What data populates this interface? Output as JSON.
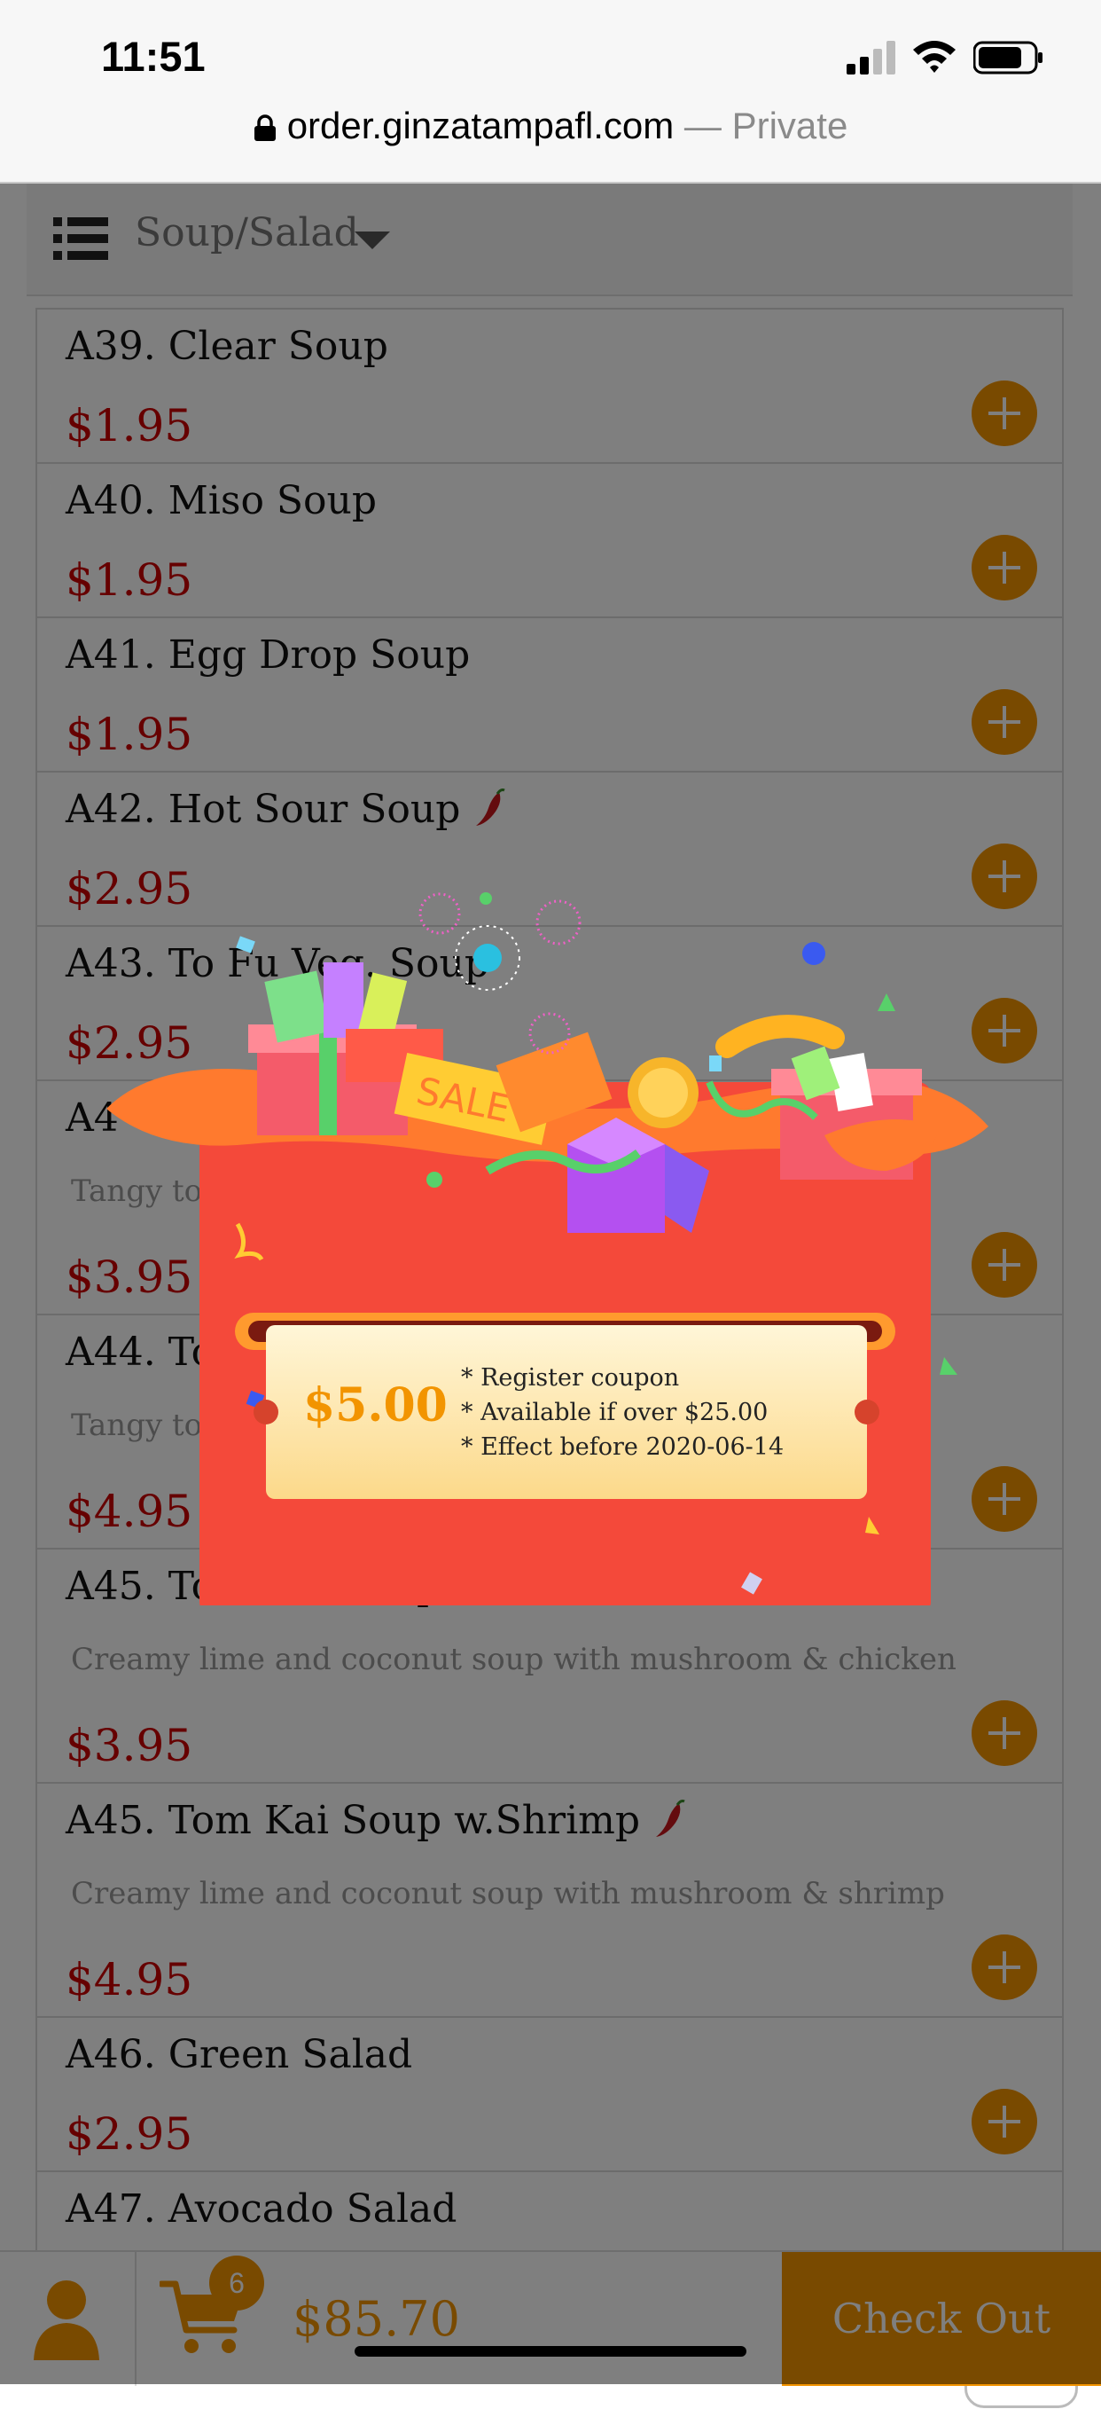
{
  "status": {
    "time": "11:51"
  },
  "browser": {
    "domain": "order.ginzatampafl.com",
    "separator": " — ",
    "mode": "Private"
  },
  "category": {
    "label": "Soup/Salad"
  },
  "menu": [
    {
      "name": "A39. Clear Soup",
      "price": "$1.95",
      "desc": "",
      "spicy": false
    },
    {
      "name": "A40. Miso Soup",
      "price": "$1.95",
      "desc": "",
      "spicy": false
    },
    {
      "name": "A41. Egg Drop Soup",
      "price": "$1.95",
      "desc": "",
      "spicy": false
    },
    {
      "name": "A42. Hot Sour Soup",
      "price": "$2.95",
      "desc": "",
      "spicy": true
    },
    {
      "name": "A43. To Fu Veg. Soup",
      "price": "$2.95",
      "desc": "",
      "spicy": false
    },
    {
      "name": "A4",
      "price": "$3.95",
      "desc": "Tangy to",
      "spicy": false
    },
    {
      "name": "A44. To",
      "price": "$4.95",
      "desc": "Tangy to",
      "spicy": false
    },
    {
      "name": "A45. Tom Kai Soup w.Chicken",
      "price": "$3.95",
      "desc": "Creamy lime and coconut soup with mushroom & chicken",
      "spicy": true
    },
    {
      "name": "A45. Tom Kai Soup w.Shrimp",
      "price": "$4.95",
      "desc": "Creamy lime and coconut soup with mushroom & shrimp",
      "spicy": true
    },
    {
      "name": "A46. Green Salad",
      "price": "$2.95",
      "desc": "",
      "spicy": false
    },
    {
      "name": "A47. Avocado Salad",
      "price": "",
      "desc": "",
      "spicy": false
    }
  ],
  "cart": {
    "count": "6",
    "total": "$85.70"
  },
  "checkout": {
    "label": "Check Out"
  },
  "coupon": {
    "amount": "$5.00",
    "line1": "* Register coupon",
    "line2": "* Available if over $25.00",
    "line3": "* Effect before 2020-06-14",
    "banner_text": "SALE"
  },
  "colors": {
    "accent": "#f29400",
    "price": "#cc0000",
    "popup_red": "#f4493a"
  }
}
